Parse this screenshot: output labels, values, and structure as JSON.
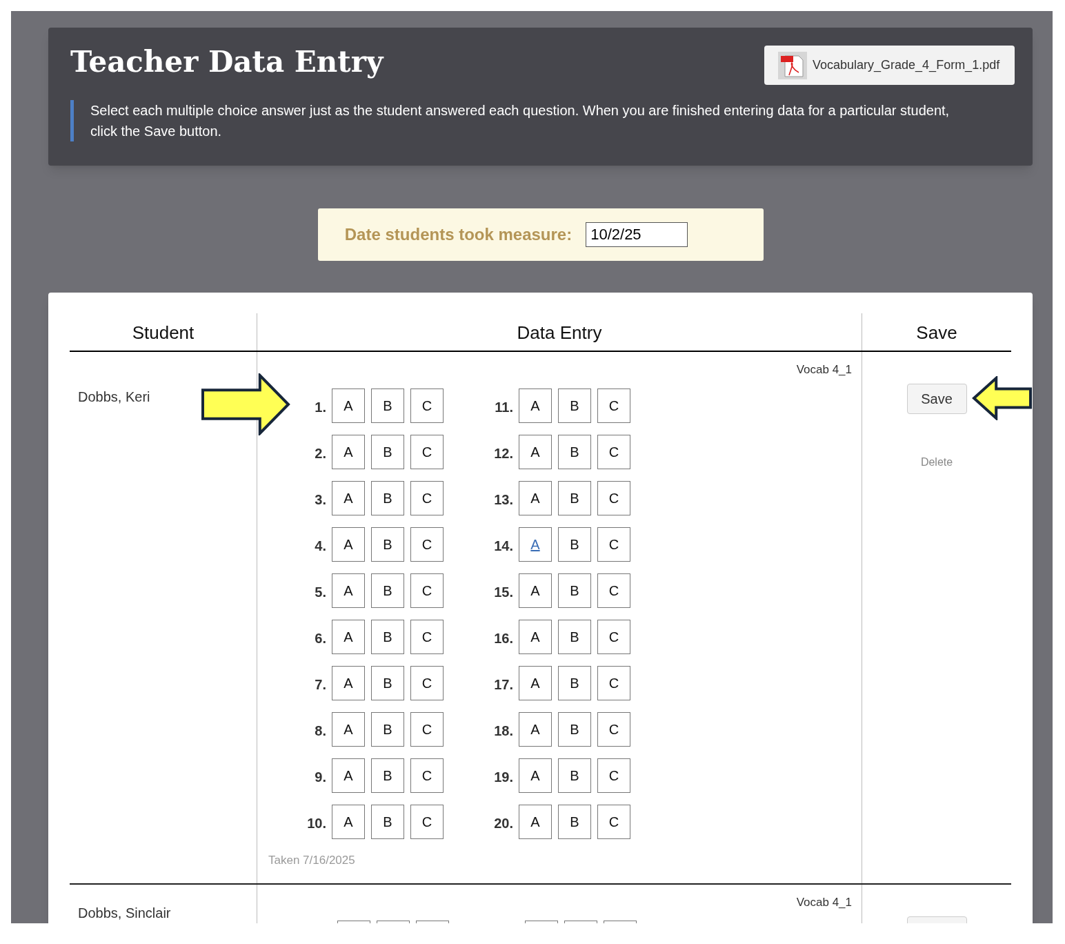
{
  "header": {
    "title": "Teacher Data Entry",
    "file": {
      "name": "Vocabulary_Grade_4_Form_1.pdf"
    },
    "instructions": "Select each multiple choice answer just as the student answered each question. When you are finished entering data for a particular student, click the Save button."
  },
  "date": {
    "label": "Date students took measure:",
    "value": "10/2/25"
  },
  "table": {
    "columns": [
      "Student",
      "Data Entry",
      "Save"
    ]
  },
  "students": [
    {
      "name": "Dobbs, Keri",
      "form": "Vocab 4_1",
      "taken": "Taken 7/16/2025",
      "save": "Save",
      "delete": "Delete",
      "arrows": true,
      "questions": [
        {
          "number": "1.",
          "options": [
            {
              "label": "A",
              "focused": false
            },
            {
              "label": "B",
              "focused": false
            },
            {
              "label": "C",
              "focused": false
            }
          ]
        },
        {
          "number": "2.",
          "options": [
            {
              "label": "A",
              "focused": false
            },
            {
              "label": "B",
              "focused": false
            },
            {
              "label": "C",
              "focused": false
            }
          ]
        },
        {
          "number": "3.",
          "options": [
            {
              "label": "A",
              "focused": false
            },
            {
              "label": "B",
              "focused": false
            },
            {
              "label": "C",
              "focused": false
            }
          ]
        },
        {
          "number": "4.",
          "options": [
            {
              "label": "A",
              "focused": false
            },
            {
              "label": "B",
              "focused": false
            },
            {
              "label": "C",
              "focused": false
            }
          ]
        },
        {
          "number": "5.",
          "options": [
            {
              "label": "A",
              "focused": false
            },
            {
              "label": "B",
              "focused": false
            },
            {
              "label": "C",
              "focused": false
            }
          ]
        },
        {
          "number": "6.",
          "options": [
            {
              "label": "A",
              "focused": false
            },
            {
              "label": "B",
              "focused": false
            },
            {
              "label": "C",
              "focused": false
            }
          ]
        },
        {
          "number": "7.",
          "options": [
            {
              "label": "A",
              "focused": false
            },
            {
              "label": "B",
              "focused": false
            },
            {
              "label": "C",
              "focused": false
            }
          ]
        },
        {
          "number": "8.",
          "options": [
            {
              "label": "A",
              "focused": false
            },
            {
              "label": "B",
              "focused": false
            },
            {
              "label": "C",
              "focused": false
            }
          ]
        },
        {
          "number": "9.",
          "options": [
            {
              "label": "A",
              "focused": false
            },
            {
              "label": "B",
              "focused": false
            },
            {
              "label": "C",
              "focused": false
            }
          ]
        },
        {
          "number": "10.",
          "options": [
            {
              "label": "A",
              "focused": false
            },
            {
              "label": "B",
              "focused": false
            },
            {
              "label": "C",
              "focused": false
            }
          ]
        },
        {
          "number": "11.",
          "options": [
            {
              "label": "A",
              "focused": false
            },
            {
              "label": "B",
              "focused": false
            },
            {
              "label": "C",
              "focused": false
            }
          ]
        },
        {
          "number": "12.",
          "options": [
            {
              "label": "A",
              "focused": false
            },
            {
              "label": "B",
              "focused": false
            },
            {
              "label": "C",
              "focused": false
            }
          ]
        },
        {
          "number": "13.",
          "options": [
            {
              "label": "A",
              "focused": false
            },
            {
              "label": "B",
              "focused": false
            },
            {
              "label": "C",
              "focused": false
            }
          ]
        },
        {
          "number": "14.",
          "options": [
            {
              "label": "A",
              "focused": true
            },
            {
              "label": "B",
              "focused": false
            },
            {
              "label": "C",
              "focused": false
            }
          ]
        },
        {
          "number": "15.",
          "options": [
            {
              "label": "A",
              "focused": false
            },
            {
              "label": "B",
              "focused": false
            },
            {
              "label": "C",
              "focused": false
            }
          ]
        },
        {
          "number": "16.",
          "options": [
            {
              "label": "A",
              "focused": false
            },
            {
              "label": "B",
              "focused": false
            },
            {
              "label": "C",
              "focused": false
            }
          ]
        },
        {
          "number": "17.",
          "options": [
            {
              "label": "A",
              "focused": false
            },
            {
              "label": "B",
              "focused": false
            },
            {
              "label": "C",
              "focused": false
            }
          ]
        },
        {
          "number": "18.",
          "options": [
            {
              "label": "A",
              "focused": false
            },
            {
              "label": "B",
              "focused": false
            },
            {
              "label": "C",
              "focused": false
            }
          ]
        },
        {
          "number": "19.",
          "options": [
            {
              "label": "A",
              "focused": false
            },
            {
              "label": "B",
              "focused": false
            },
            {
              "label": "C",
              "focused": false
            }
          ]
        },
        {
          "number": "20.",
          "options": [
            {
              "label": "A",
              "focused": false
            },
            {
              "label": "B",
              "focused": false
            },
            {
              "label": "C",
              "focused": false
            }
          ]
        }
      ]
    },
    {
      "name": "Dobbs, Sinclair",
      "form": "Vocab 4_1",
      "arrows": false
    }
  ]
}
